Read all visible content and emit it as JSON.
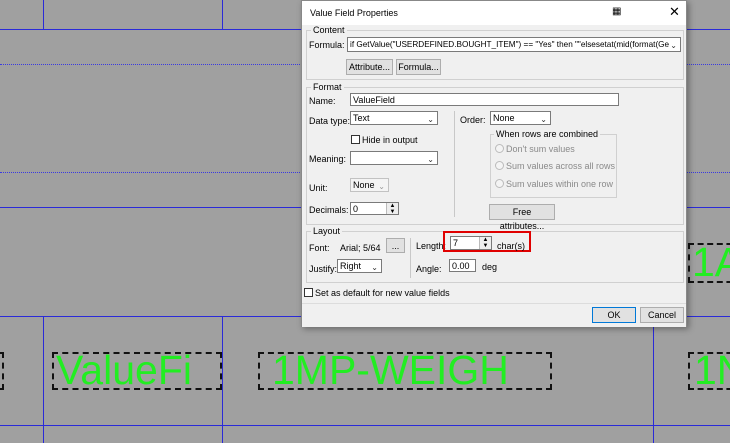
{
  "canvas": {
    "field_texts": [
      "ValueFi",
      "1MP-WEIGH",
      "1N",
      "1A"
    ]
  },
  "dialog": {
    "title": "Value Field Properties",
    "content": {
      "group_title": "Content",
      "formula_label": "Formula:",
      "formula_value": "if GetValue(\"USERDEFINED.BOUGHT_ITEM\") == \"Yes\" then  \"\"elsesetat(mid(format(Ge",
      "attribute_button": "Attribute...",
      "formula_button": "Formula..."
    },
    "format": {
      "group_title": "Format",
      "name_label": "Name:",
      "name_value": "ValueField",
      "datatype_label": "Data type:",
      "datatype_value": "Text",
      "order_label": "Order:",
      "order_value": "None",
      "hide_label": "Hide in output",
      "combined_title": "When rows are combined",
      "radio_dont_sum": "Don't sum values",
      "radio_sum_all": "Sum values across all rows",
      "radio_sum_within": "Sum values within one row",
      "meaning_label": "Meaning:",
      "meaning_value": "",
      "unit_label": "Unit:",
      "unit_value": "None",
      "decimals_label": "Decimals:",
      "decimals_value": "0",
      "free_attributes_button": "Free attributes..."
    },
    "layout": {
      "group_title": "Layout",
      "font_label": "Font:",
      "font_value": "Arial; 5/64",
      "font_button": "...",
      "length_label": "Length:",
      "length_value": "7",
      "length_unit": "char(s)",
      "justify_label": "Justify:",
      "justify_value": "Right",
      "angle_label": "Angle:",
      "angle_value": "0.00",
      "angle_unit": "deg"
    },
    "default_checkbox_label": "Set as default for new value fields",
    "ok_button": "OK",
    "cancel_button": "Cancel"
  },
  "colors": {
    "canvas_background": "#a0a0a0",
    "grid_line": "#2a2ad8",
    "field_text": "#22ee22",
    "highlight": "#e00000"
  }
}
